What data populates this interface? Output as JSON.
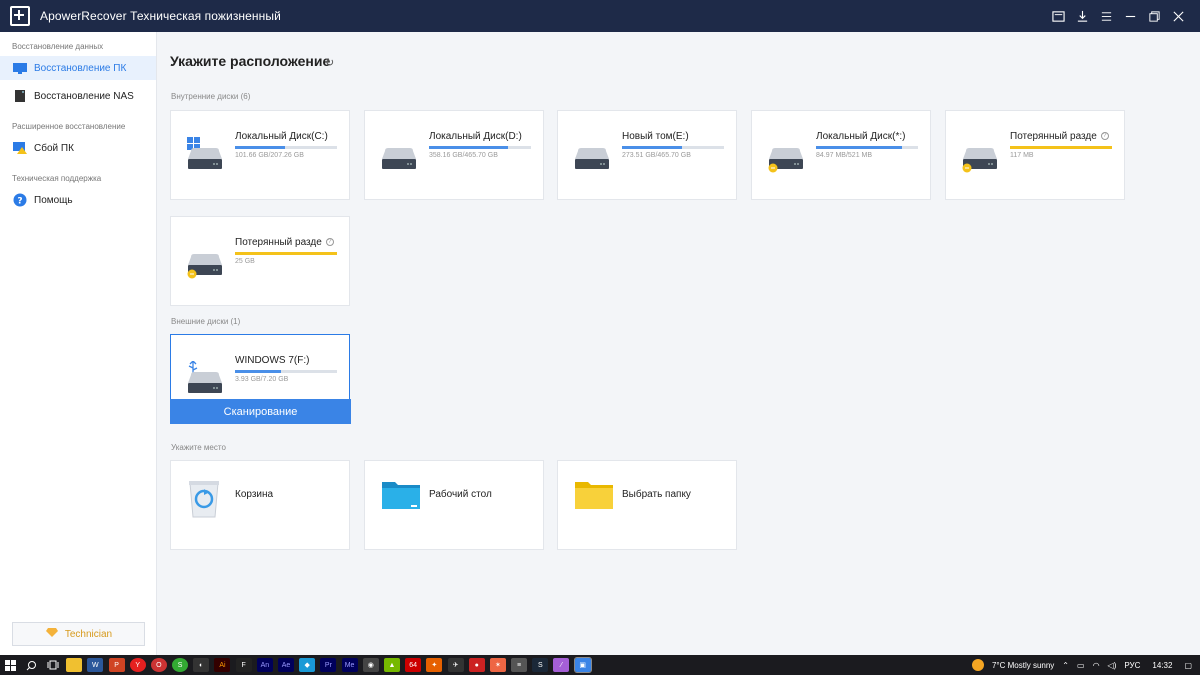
{
  "window": {
    "title": "ApowerRecover Техническая пожизненный"
  },
  "sidebar": {
    "groups": [
      {
        "label": "Восстановление данных",
        "items": [
          {
            "label": "Восстановление ПК",
            "icon": "monitor-icon",
            "active": true
          },
          {
            "label": "Восстановление NAS",
            "icon": "nas-icon",
            "active": false
          }
        ]
      },
      {
        "label": "Расширенное восстановление",
        "items": [
          {
            "label": "Сбой ПК",
            "icon": "pc-crash-icon",
            "active": false
          }
        ]
      },
      {
        "label": "Техническая поддержка",
        "items": [
          {
            "label": "Помощь",
            "icon": "help-icon",
            "active": false
          }
        ]
      }
    ],
    "technician_label": "Technician"
  },
  "main": {
    "title": "Укажите расположение",
    "internal_label": "Внутренние диски (6)",
    "external_label": "Внешние диски (1)",
    "location_label": "Укажите место",
    "scan_label": "Сканирование",
    "internal_disks": [
      {
        "name": "Локальный Диск(C:)",
        "size": "101.66 GB/207.26 GB",
        "usage": 0.49,
        "os": true,
        "warning": false,
        "help": false
      },
      {
        "name": "Локальный Диск(D:)",
        "size": "358.16 GB/465.70 GB",
        "usage": 0.77,
        "os": false,
        "warning": false,
        "help": false
      },
      {
        "name": "Новый том(E:)",
        "size": "273.51 GB/465.70 GB",
        "usage": 0.59,
        "os": false,
        "warning": false,
        "help": false
      },
      {
        "name": "Локальный Диск(*:)",
        "size": "84.97 MB/521 MB",
        "usage": 0.84,
        "os": false,
        "warning": true,
        "help": false
      },
      {
        "name": "Потерянный разде",
        "size": "117 MB",
        "usage": 1.0,
        "os": false,
        "warning": true,
        "help": true,
        "lost": true
      },
      {
        "name": "Потерянный разде",
        "size": "25 GB",
        "usage": 1.0,
        "os": false,
        "warning": true,
        "help": true,
        "lost": true
      }
    ],
    "external_disks": [
      {
        "name": "WINDOWS 7(F:)",
        "size": "3.93 GB/7.20 GB",
        "usage": 0.45,
        "usb": true
      }
    ],
    "locations": [
      {
        "name": "Корзина",
        "icon": "recycle-bin-icon"
      },
      {
        "name": "Рабочий стол",
        "icon": "desktop-folder-icon"
      },
      {
        "name": "Выбрать папку",
        "icon": "folder-icon"
      }
    ]
  },
  "taskbar": {
    "weather": "7°C  Mostly sunny",
    "lang": "РУС",
    "time": "14:32"
  },
  "colors": {
    "accent": "#3a84e6",
    "titlebar": "#1e2a48",
    "warning": "#f4c21a"
  }
}
